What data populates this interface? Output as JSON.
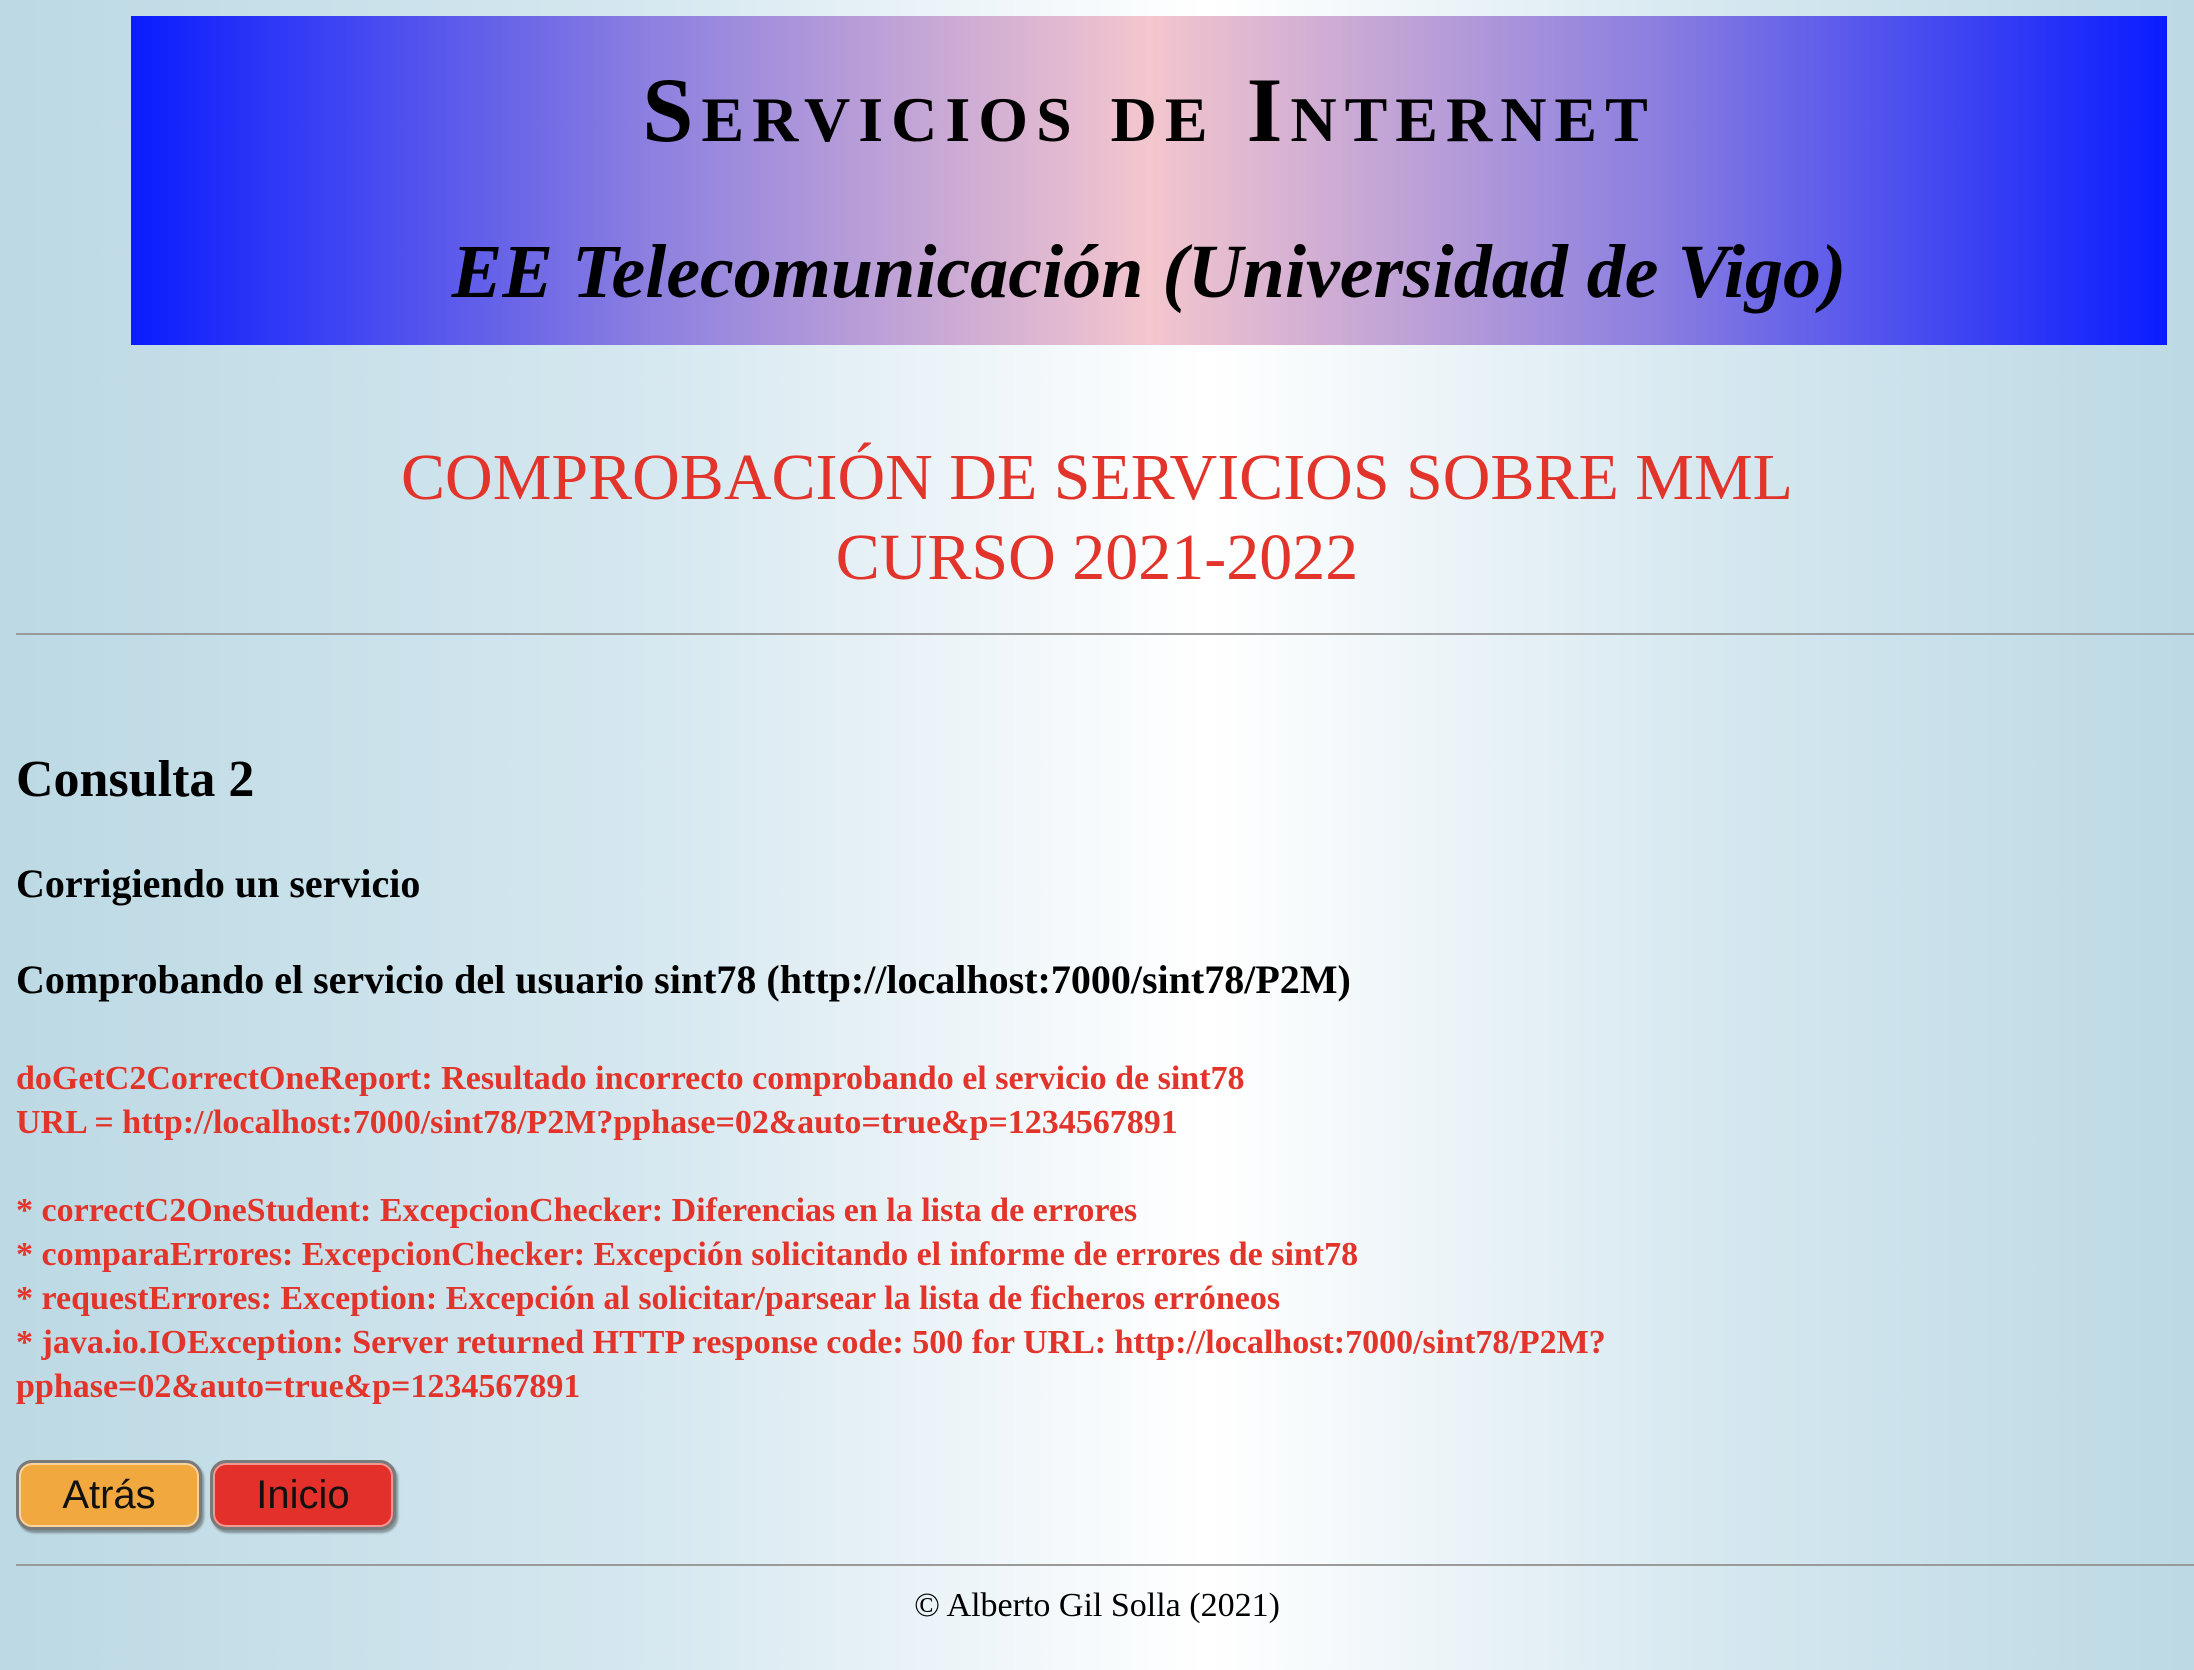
{
  "banner": {
    "title": "Servicios de Internet",
    "subtitle": "EE Telecomunicación (Universidad de Vigo)"
  },
  "heading": {
    "line1": "COMPROBACIÓN DE SERVICIOS SOBRE MML",
    "line2": "CURSO 2021-2022"
  },
  "section": {
    "consulta": "Consulta 2",
    "corrigiendo": "Corrigiendo un servicio",
    "comprobando": "Comprobando el servicio del usuario sint78 (http://localhost:7000/sint78/P2M)"
  },
  "report": {
    "summary": "doGetC2CorrectOneReport: Resultado incorrecto comprobando el servicio de sint78",
    "url": "URL = http://localhost:7000/sint78/P2M?pphase=02&auto=true&p=1234567891",
    "errors": [
      "* correctC2OneStudent: ExcepcionChecker: Diferencias en la lista de errores",
      "* comparaErrores: ExcepcionChecker: Excepción solicitando el informe de errores de sint78",
      "* requestErrores: Exception: Excepción al solicitar/parsear la lista de ficheros erróneos",
      "* java.io.IOException: Server returned HTTP response code: 500 for URL: http://localhost:7000/sint78/P2M?",
      "pphase=02&auto=true&p=1234567891"
    ]
  },
  "buttons": {
    "back": "Atrás",
    "home": "Inicio"
  },
  "footer": {
    "copyright": "© Alberto Gil Solla (2021)"
  },
  "colors": {
    "accent_red": "#e2342a",
    "back_button": "#f1a93f",
    "home_button": "#e3302a",
    "banner_blue": "#0a1cff",
    "banner_pink": "#f4c6cd"
  }
}
